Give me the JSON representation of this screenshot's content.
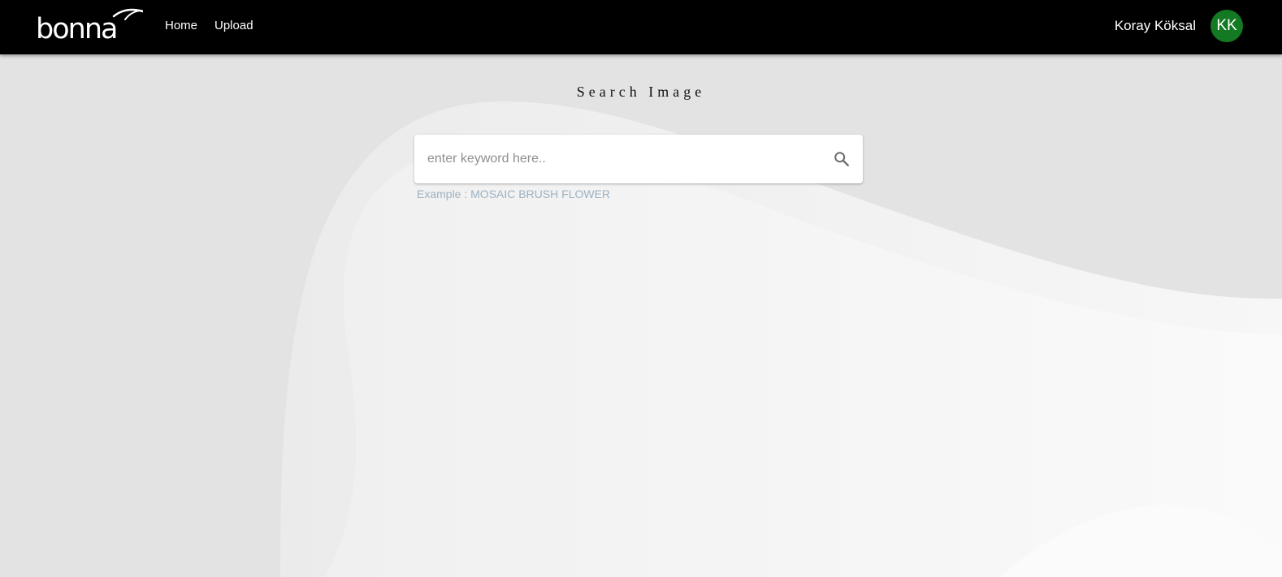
{
  "app": {
    "brand": "bonna",
    "colors": {
      "navbar": "#000000",
      "avatar": "#137a23",
      "hint": "#9db2c2",
      "background": "#e4e4e4"
    }
  },
  "nav": {
    "links": [
      {
        "label": "Home"
      },
      {
        "label": "Upload"
      }
    ]
  },
  "user": {
    "name": "Koray Köksal",
    "initials": "KK"
  },
  "main": {
    "title": "Search Image",
    "search": {
      "placeholder": "enter keyword here..",
      "value": "",
      "icon": "search-icon"
    },
    "example": "Example : MOSAIC BRUSH FLOWER"
  }
}
